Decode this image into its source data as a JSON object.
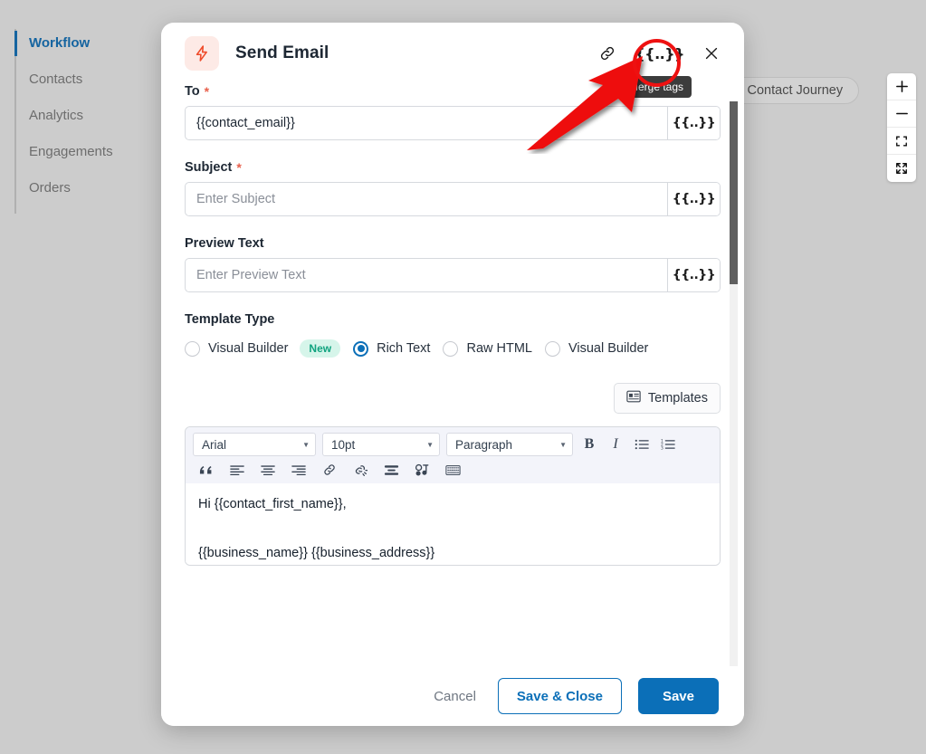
{
  "sidebar": {
    "items": [
      {
        "label": "Workflow",
        "active": true
      },
      {
        "label": "Contacts",
        "active": false
      },
      {
        "label": "Analytics",
        "active": false
      },
      {
        "label": "Engagements",
        "active": false
      },
      {
        "label": "Orders",
        "active": false
      }
    ]
  },
  "canvas": {
    "journey_button_label": "w Contact Journey",
    "zoom_controls": [
      {
        "name": "zoom-in-icon",
        "glyph": "+"
      },
      {
        "name": "zoom-out-icon",
        "glyph": "−"
      },
      {
        "name": "fit-view-icon",
        "glyph": "fit"
      },
      {
        "name": "fullscreen-icon",
        "glyph": "expand"
      }
    ]
  },
  "modal": {
    "icon": "lightning-bolt-icon",
    "title": "Send Email",
    "header_actions": [
      {
        "name": "link-icon",
        "label": ""
      },
      {
        "name": "merge-tags-icon",
        "label": "{{..}}"
      },
      {
        "name": "close-icon",
        "label": "✕"
      }
    ],
    "tooltip": "Merge tags",
    "merge_tag_glyph": "{{..}}",
    "fields": [
      {
        "label": "To",
        "required": true,
        "value": "{{contact_email}}",
        "placeholder": "",
        "merge_tag": "{{..}}"
      },
      {
        "label": "Subject",
        "required": true,
        "value": "",
        "placeholder": "Enter Subject",
        "merge_tag": "{{..}}"
      },
      {
        "label": "Preview Text",
        "required": false,
        "value": "",
        "placeholder": "Enter Preview Text",
        "merge_tag": "{{..}}"
      }
    ],
    "template_type": {
      "label": "Template Type",
      "options": [
        {
          "label": "Visual Builder",
          "checked": false,
          "badge": "New"
        },
        {
          "label": "Rich Text",
          "checked": true,
          "badge": ""
        },
        {
          "label": "Raw HTML",
          "checked": false,
          "badge": ""
        },
        {
          "label": "Visual Builder",
          "checked": false,
          "badge": ""
        }
      ]
    },
    "templates_button": "Templates",
    "editor": {
      "font_family": "Arial",
      "font_size": "10pt",
      "block_format": "Paragraph",
      "caret": "▾",
      "tools_row1": [
        {
          "name": "bold-icon",
          "glyph": "B"
        },
        {
          "name": "italic-icon",
          "glyph": "I"
        },
        {
          "name": "bullet-list-icon",
          "glyph": "list"
        },
        {
          "name": "numbered-list-icon",
          "glyph": "olist"
        }
      ],
      "tools_row2": [
        {
          "name": "blockquote-icon",
          "glyph": "“"
        },
        {
          "name": "align-left-icon",
          "glyph": "align-left"
        },
        {
          "name": "align-center-icon",
          "glyph": "align-center"
        },
        {
          "name": "align-right-icon",
          "glyph": "align-right"
        },
        {
          "name": "insert-link-icon",
          "glyph": "link"
        },
        {
          "name": "unlink-icon",
          "glyph": "unlink"
        },
        {
          "name": "horizontal-rule-icon",
          "glyph": "hr"
        },
        {
          "name": "media-icon",
          "glyph": "media"
        },
        {
          "name": "special-character-icon",
          "glyph": "keyboard"
        }
      ],
      "body_line1": "Hi {{contact_first_name}},",
      "body_line2": "{{business_name}} {{business_address}}"
    },
    "footer": {
      "cancel": "Cancel",
      "save_and_close": "Save & Close",
      "save": "Save"
    }
  },
  "colors": {
    "accent_blue": "#0b6fb8",
    "sidebar_active": "#1564a0",
    "required_star": "#e8604c",
    "badge_new_text": "#10a37f",
    "badge_new_bg": "#d6f5ea",
    "bolt_bg": "#fdeae6",
    "bolt_fg": "#ef4b2a",
    "annotation_red": "#ee1111",
    "tooltip_bg": "#3c3c3c",
    "overlay_bg": "#cccccc"
  }
}
